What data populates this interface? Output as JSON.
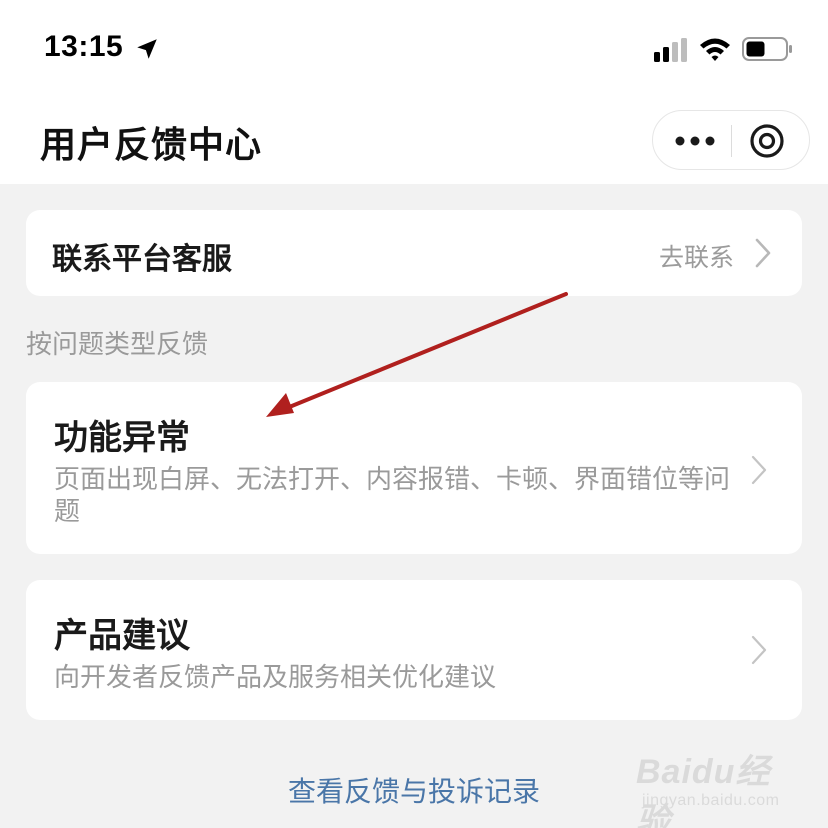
{
  "status_bar": {
    "time": "13:15",
    "icons": [
      "location-arrow-icon",
      "signal-icon",
      "wifi-icon",
      "battery-icon"
    ]
  },
  "nav": {
    "title": "用户反馈中心",
    "more_icon": "more-dots-icon",
    "close_icon": "close-circle-icon"
  },
  "contact": {
    "label": "联系平台客服",
    "action": "去联系"
  },
  "section": {
    "title": "按问题类型反馈"
  },
  "items": [
    {
      "title": "功能异常",
      "desc": "页面出现白屏、无法打开、内容报错、卡顿、界面错位等问题"
    },
    {
      "title": "产品建议",
      "desc": "向开发者反馈产品及服务相关优化建议"
    }
  ],
  "footer": {
    "records_link": "查看反馈与投诉记录"
  },
  "watermark": {
    "logo": "Baidu经验",
    "sub": "jingyan.baidu.com"
  },
  "colors": {
    "background": "#f2f2f2",
    "card": "#ffffff",
    "link": "#4a76a8",
    "annotation_arrow": "#b0201e",
    "secondary_text": "#9a9a9a"
  }
}
